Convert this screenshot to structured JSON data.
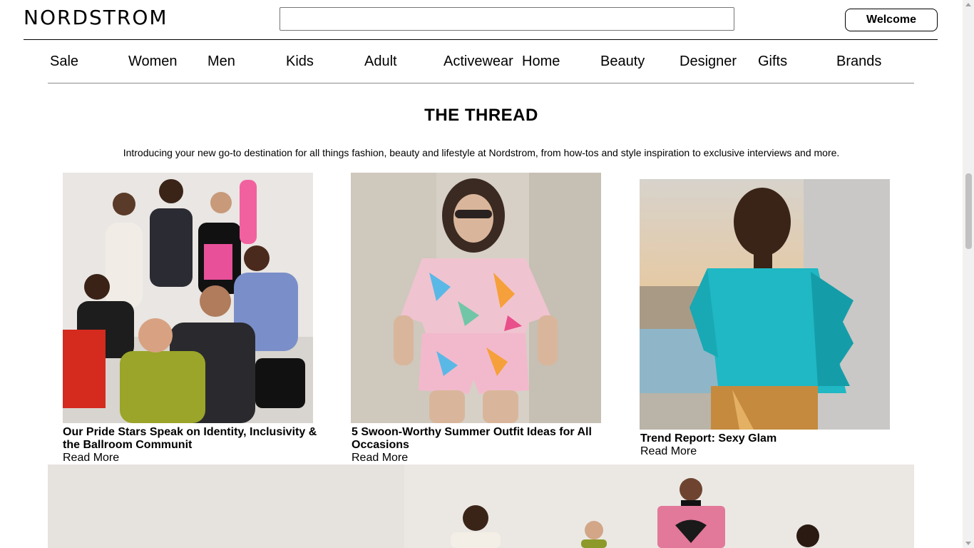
{
  "header": {
    "logo": "NORDSTROM",
    "search": {
      "value": "",
      "placeholder": ""
    },
    "welcome_label": "Welcome"
  },
  "nav": {
    "items": [
      {
        "label": "Sale"
      },
      {
        "label": "Women"
      },
      {
        "label": "Men"
      },
      {
        "label": "Kids"
      },
      {
        "label": "Adult"
      },
      {
        "label": "Activewear"
      },
      {
        "label": "Home"
      },
      {
        "label": "Beauty"
      },
      {
        "label": "Designer"
      },
      {
        "label": "Gifts"
      },
      {
        "label": "Brands"
      }
    ]
  },
  "main": {
    "title": "THE THREAD",
    "intro": "Introducing your new go-to destination for all things fashion, beauty and lifestyle at Nordstrom, from how-tos and style inspiration to exclusive interviews and more.",
    "cards": [
      {
        "title": "Our Pride Stars Speak on Identity, Inclusivity & the Ballroom Communit",
        "link": "Read More"
      },
      {
        "title": "5 Swoon-Worthy Summer Outfit Ideas for All Occasions",
        "link": "Read More"
      },
      {
        "title": "Trend Report: Sexy Glam",
        "link": "Read More"
      }
    ]
  },
  "colors": {
    "accent_teal": "#1fb8c4",
    "background": "#ffffff",
    "text": "#000000"
  }
}
